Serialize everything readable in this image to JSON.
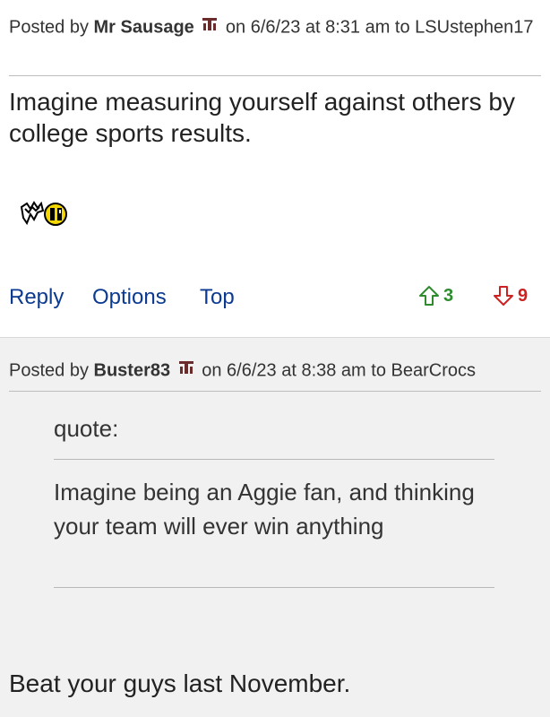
{
  "post1": {
    "meta_prefix": "Posted by",
    "author": "Mr Sausage",
    "meta_middle": "on 6/6/23 at 8:31 am to",
    "recipient": "LSUstephen17",
    "body": "Imagine measuring yourself against others by college sports results.",
    "emote_icon": "running-smiley-emote-icon",
    "actions": {
      "reply": "Reply",
      "options": "Options",
      "top": "Top"
    },
    "upvotes": "3",
    "downvotes": "9",
    "colors": {
      "upvote": "#2e8b2e",
      "downvote": "#cc2222",
      "link": "#0b3a8f"
    }
  },
  "post2": {
    "meta_prefix": "Posted by",
    "author": "Buster83",
    "meta_middle": "on 6/6/23 at 8:38 am to",
    "recipient": "BearCrocs",
    "quote_label": "quote:",
    "quote_text": "Imagine being an Aggie fan, and thinking your team will ever win anything",
    "body": "Beat your guys last November."
  }
}
